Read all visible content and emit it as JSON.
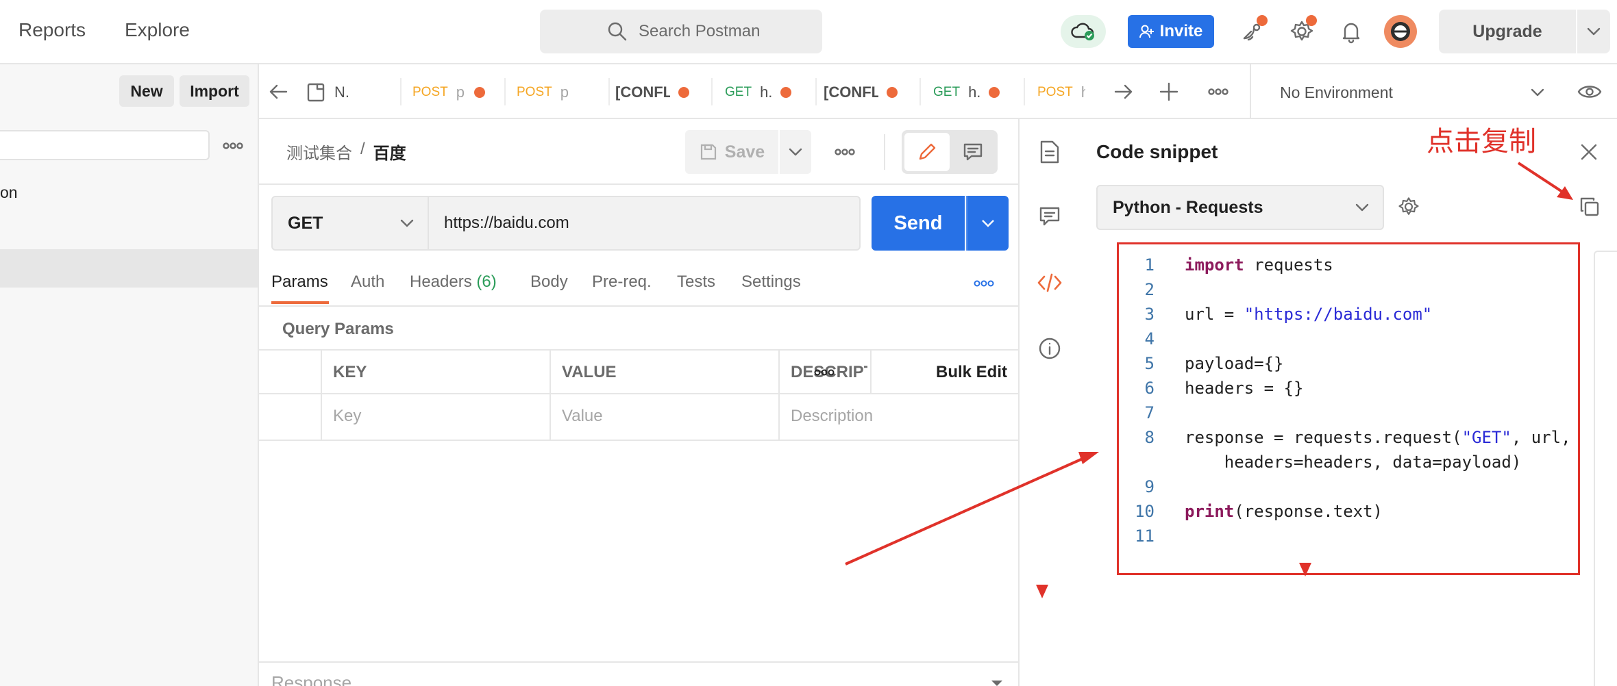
{
  "topbar": {
    "nav": [
      "Reports",
      "Explore"
    ],
    "search_placeholder": "Search Postman",
    "invite_label": "Invite",
    "upgrade_label": "Upgrade"
  },
  "sidebar": {
    "new_label": "New",
    "import_label": "Import",
    "item_partial": "on"
  },
  "tabs": [
    {
      "method": "",
      "label": "N."
    },
    {
      "method": "POST",
      "label": "p"
    },
    {
      "method": "POST",
      "label": "p"
    },
    {
      "method": "",
      "label": "[CONFL"
    },
    {
      "method": "GET",
      "label": "h."
    },
    {
      "method": "",
      "label": "[CONFL"
    },
    {
      "method": "GET",
      "label": "h."
    },
    {
      "method": "POST",
      "label": "h"
    }
  ],
  "environment": {
    "selected": "No Environment"
  },
  "request": {
    "breadcrumb_parent": "测试集合",
    "breadcrumb_sep": "/",
    "breadcrumb_current": "百度",
    "save_label": "Save",
    "method": "GET",
    "url": "https://baidu.com",
    "send_label": "Send"
  },
  "request_tabs": {
    "params": "Params",
    "auth": "Auth",
    "headers": "Headers",
    "headers_count": "(6)",
    "body": "Body",
    "prereq": "Pre-req.",
    "tests": "Tests",
    "settings": "Settings"
  },
  "query_params": {
    "title": "Query Params",
    "columns": [
      "KEY",
      "VALUE",
      "DESCRIPT"
    ],
    "bulk_edit": "Bulk Edit",
    "placeholders": [
      "Key",
      "Value",
      "Description"
    ]
  },
  "response": {
    "label": "Response"
  },
  "code_snippet": {
    "title": "Code snippet",
    "language": "Python - Requests",
    "annotation": "点击复制",
    "line_numbers": [
      "1",
      "2",
      "3",
      "4",
      "5",
      "6",
      "7",
      "8",
      "",
      "9",
      "10",
      "11"
    ],
    "code": {
      "l1_kw": "import",
      "l1_rest": " requests",
      "l3_pre": "url = ",
      "l3_str": "\"https://baidu.com\"",
      "l5": "payload={}",
      "l6": "headers = {}",
      "l8_pre": "response = requests.request(",
      "l8_str": "\"GET\"",
      "l8_post": ", url,",
      "l8b": "    headers=headers, data=payload)",
      "l10_kw": "print",
      "l10_rest": "(response.text)"
    }
  },
  "colors": {
    "accent_blue": "#2771e6",
    "orange": "#ed6a3b",
    "annotation_red": "#e0322a",
    "cloud_green": "#2b9c59"
  }
}
